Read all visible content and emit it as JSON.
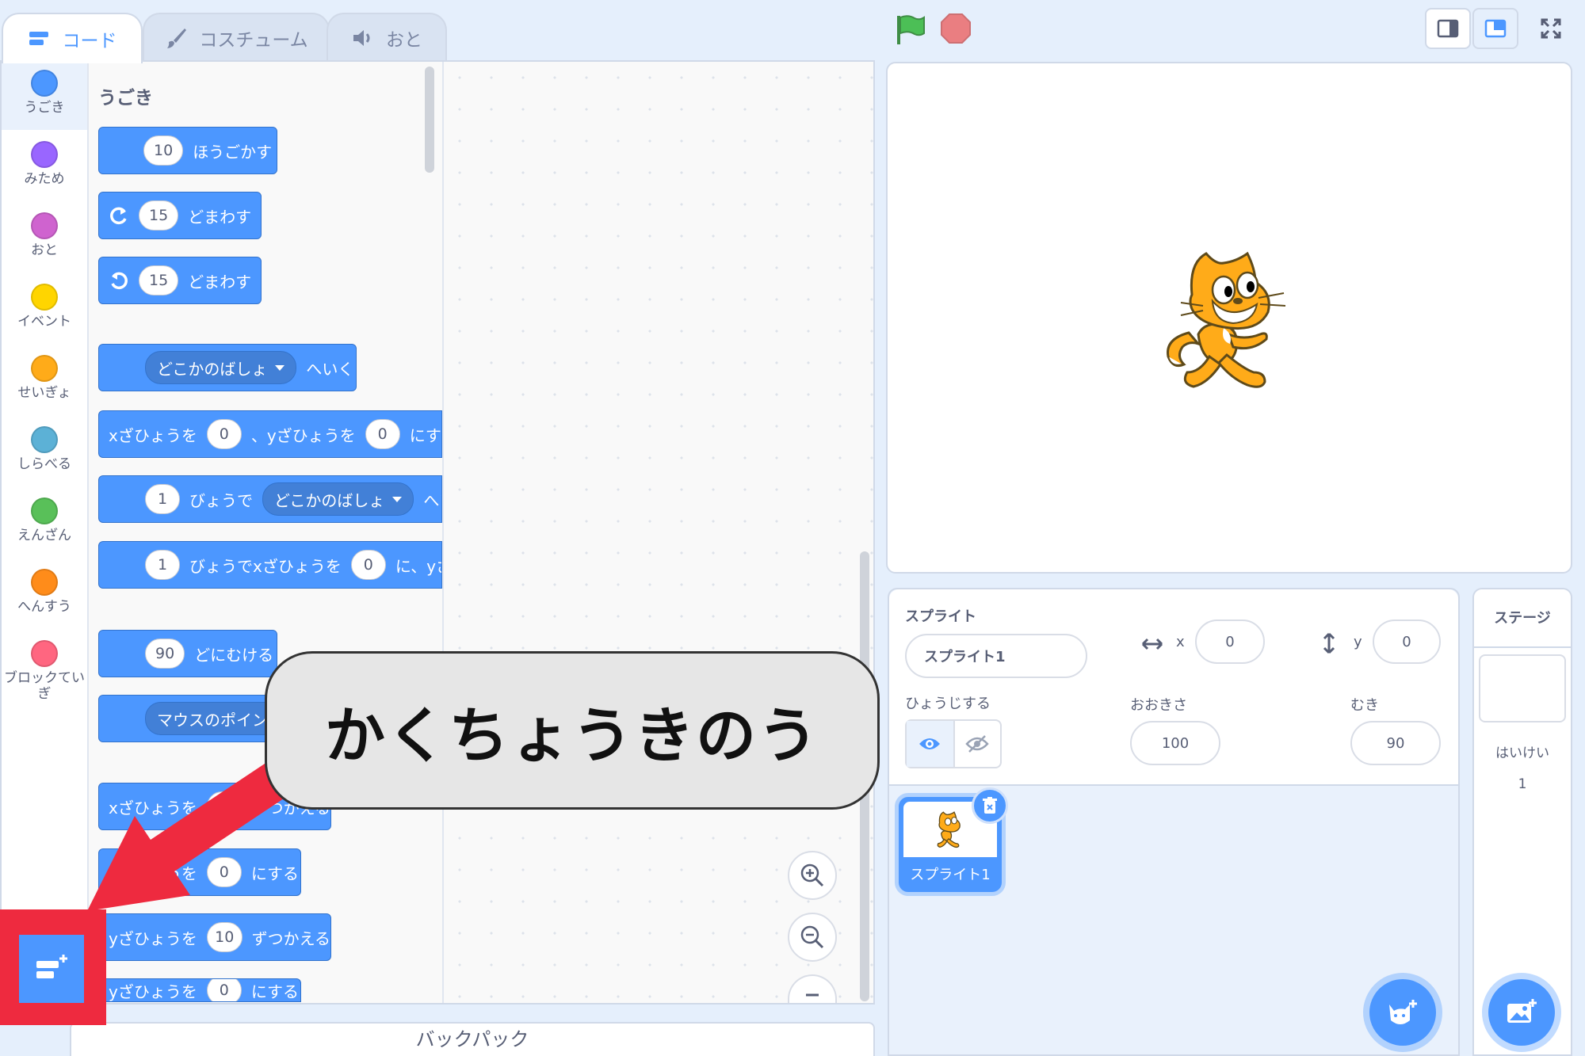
{
  "tabs": [
    {
      "label": "コード",
      "active": true
    },
    {
      "label": "コスチューム",
      "active": false
    },
    {
      "label": "おと",
      "active": false
    }
  ],
  "categories": [
    {
      "label": "うごき",
      "color": "#4c97ff"
    },
    {
      "label": "みため",
      "color": "#9966ff"
    },
    {
      "label": "おと",
      "color": "#cf63cf"
    },
    {
      "label": "イベント",
      "color": "#ffd500"
    },
    {
      "label": "せいぎょ",
      "color": "#ffab19"
    },
    {
      "label": "しらべる",
      "color": "#5cb1d6"
    },
    {
      "label": "えんざん",
      "color": "#59c059"
    },
    {
      "label": "へんすう",
      "color": "#ff8c1a"
    },
    {
      "label": "ブロックてい",
      "label2": "ぎ",
      "color": "#ff6680"
    }
  ],
  "palette": {
    "section_title": "うごき",
    "blocks": {
      "move": {
        "value": "10",
        "text": "ほうごかす"
      },
      "turn_right": {
        "value": "15",
        "text": "どまわす"
      },
      "turn_left": {
        "value": "15",
        "text": "どまわす"
      },
      "goto": {
        "dropdown": "どこかのばしょ",
        "text": "へいく"
      },
      "goto_xy": {
        "t1": "xざひょうを",
        "x": "0",
        "t2": "、yざひょうを",
        "y": "0",
        "t3": "にする"
      },
      "glide": {
        "value": "1",
        "t1": "びょうで",
        "dropdown": "どこかのばしょ",
        "t2": "へいく"
      },
      "glide_xy": {
        "value": "1",
        "t1": "びょうでxざひょうを",
        "x": "0",
        "t2": "に、yざ"
      },
      "point_dir": {
        "value": "90",
        "text": "どにむける"
      },
      "point_towards": {
        "dropdown": "マウスのポインター"
      },
      "change_x": {
        "t1": "xざひょうを",
        "value": "10",
        "t2": "ずつかえる"
      },
      "set_x": {
        "t1": "xざひょうを",
        "value": "0",
        "t2": "にする"
      },
      "change_y": {
        "t1": "yざひょうを",
        "value": "10",
        "t2": "ずつかえる"
      },
      "set_y": {
        "t1": "yざひょうを",
        "value": "0",
        "t2": "にする"
      }
    }
  },
  "backpack_label": "バックパック",
  "sprite_info": {
    "sprite_label": "スプライト",
    "sprite_name": "スプライト1",
    "x_label": "x",
    "x_value": "0",
    "y_label": "y",
    "y_value": "0",
    "show_label": "ひょうじする",
    "size_label": "おおきさ",
    "size_value": "100",
    "direction_label": "むき",
    "direction_value": "90"
  },
  "sprite_list": [
    {
      "name": "スプライト1"
    }
  ],
  "stage_panel": {
    "title": "ステージ",
    "backdrop_label": "はいけい",
    "backdrop_count": "1"
  },
  "annotation": {
    "text": "かくちょうきのう",
    "color": "#ee2a3f"
  },
  "colors": {
    "motion": "#4c97ff",
    "flag": "#4cbf56",
    "stop": "#ec5959"
  }
}
